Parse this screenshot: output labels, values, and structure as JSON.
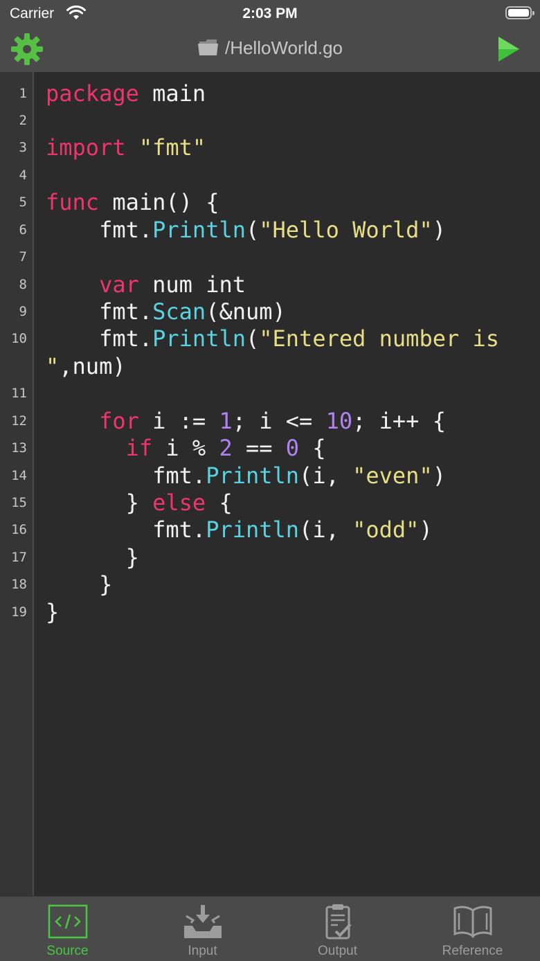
{
  "status": {
    "carrier": "Carrier",
    "time": "2:03 PM"
  },
  "nav": {
    "title": "/HelloWorld.go"
  },
  "gutter": {
    "lines": [
      "1",
      "2",
      "3",
      "4",
      "5",
      "6",
      "7",
      "8",
      "9",
      "10",
      "11",
      "12",
      "13",
      "14",
      "15",
      "16",
      "17",
      "18",
      "19"
    ]
  },
  "code": {
    "l1": [
      {
        "t": "package",
        "c": "kw"
      },
      {
        "t": " main",
        "c": ""
      }
    ],
    "l3": [
      {
        "t": "import",
        "c": "kw"
      },
      {
        "t": " ",
        "c": ""
      },
      {
        "t": "\"fmt\"",
        "c": "str"
      }
    ],
    "l5": [
      {
        "t": "func",
        "c": "kw"
      },
      {
        "t": " main() {",
        "c": ""
      }
    ],
    "l6": [
      {
        "t": "    fmt.",
        "c": ""
      },
      {
        "t": "Println",
        "c": "fn"
      },
      {
        "t": "(",
        "c": ""
      },
      {
        "t": "\"Hello World\"",
        "c": "str"
      },
      {
        "t": ")",
        "c": ""
      }
    ],
    "l8": [
      {
        "t": "    ",
        "c": ""
      },
      {
        "t": "var",
        "c": "kw"
      },
      {
        "t": " num int",
        "c": ""
      }
    ],
    "l9": [
      {
        "t": "    fmt.",
        "c": ""
      },
      {
        "t": "Scan",
        "c": "fn"
      },
      {
        "t": "(&num)",
        "c": ""
      }
    ],
    "l10a": [
      {
        "t": "    fmt.",
        "c": ""
      },
      {
        "t": "Println",
        "c": "fn"
      },
      {
        "t": "(",
        "c": ""
      },
      {
        "t": "\"Entered number is",
        "c": "str"
      }
    ],
    "l10b": [
      {
        "t": "\"",
        "c": "str"
      },
      {
        "t": ",num)",
        "c": ""
      }
    ],
    "l12": [
      {
        "t": "    ",
        "c": ""
      },
      {
        "t": "for",
        "c": "kw"
      },
      {
        "t": " i := ",
        "c": ""
      },
      {
        "t": "1",
        "c": "num"
      },
      {
        "t": "; i <= ",
        "c": ""
      },
      {
        "t": "10",
        "c": "num"
      },
      {
        "t": "; i++ {",
        "c": ""
      }
    ],
    "l13": [
      {
        "t": "      ",
        "c": ""
      },
      {
        "t": "if",
        "c": "kw"
      },
      {
        "t": " i % ",
        "c": ""
      },
      {
        "t": "2",
        "c": "num"
      },
      {
        "t": " == ",
        "c": ""
      },
      {
        "t": "0",
        "c": "num"
      },
      {
        "t": " {",
        "c": ""
      }
    ],
    "l14": [
      {
        "t": "        fmt.",
        "c": ""
      },
      {
        "t": "Println",
        "c": "fn"
      },
      {
        "t": "(i, ",
        "c": ""
      },
      {
        "t": "\"even\"",
        "c": "str"
      },
      {
        "t": ")",
        "c": ""
      }
    ],
    "l15": [
      {
        "t": "      } ",
        "c": ""
      },
      {
        "t": "else",
        "c": "kw"
      },
      {
        "t": " {",
        "c": ""
      }
    ],
    "l16": [
      {
        "t": "        fmt.",
        "c": ""
      },
      {
        "t": "Println",
        "c": "fn"
      },
      {
        "t": "(i, ",
        "c": ""
      },
      {
        "t": "\"odd\"",
        "c": "str"
      },
      {
        "t": ")",
        "c": ""
      }
    ],
    "l17": [
      {
        "t": "      }",
        "c": ""
      }
    ],
    "l18": [
      {
        "t": "    }",
        "c": ""
      }
    ],
    "l19": [
      {
        "t": "}",
        "c": ""
      }
    ]
  },
  "tabs": [
    {
      "label": "Source",
      "icon": "source-code-icon",
      "active": true
    },
    {
      "label": "Input",
      "icon": "input-tray-icon",
      "active": false
    },
    {
      "label": "Output",
      "icon": "clipboard-check-icon",
      "active": false
    },
    {
      "label": "Reference",
      "icon": "open-book-icon",
      "active": false
    }
  ],
  "colors": {
    "accent": "#48c840",
    "keyword": "#f0346d",
    "string": "#e8de86",
    "function": "#59d3e1",
    "number": "#b183f0"
  }
}
